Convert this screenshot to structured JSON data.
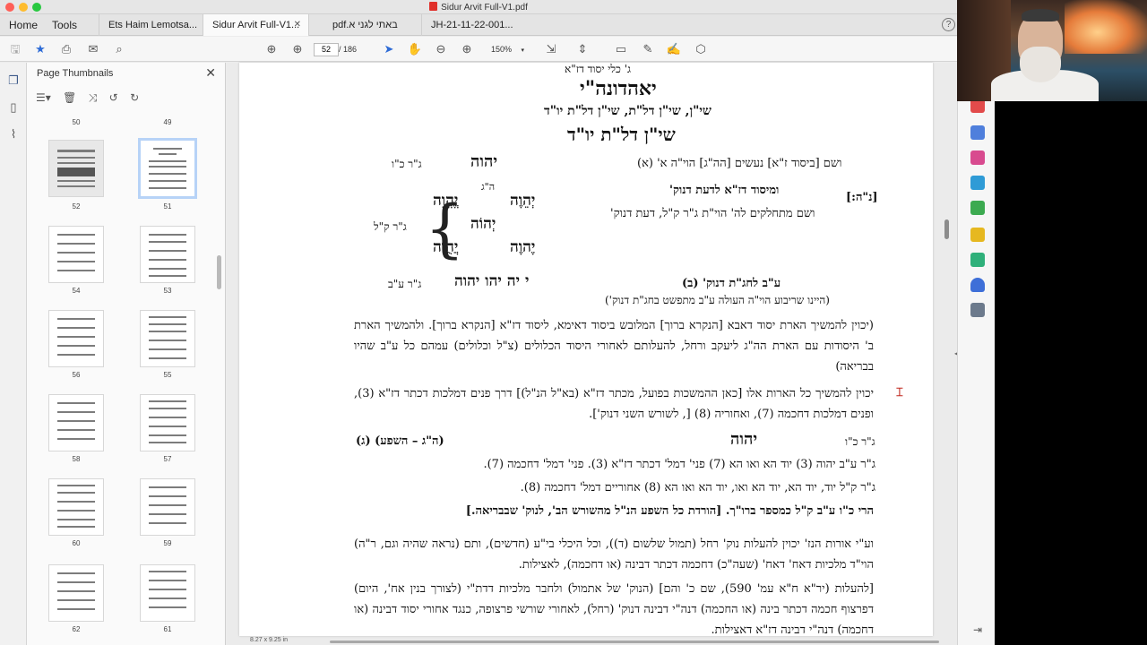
{
  "window": {
    "title": "Sidur Arvit Full-V1.pdf"
  },
  "tabs": {
    "home": "Home",
    "tools": "Tools",
    "docs": [
      {
        "label": "Ets Haim Lemotsa...",
        "active": false
      },
      {
        "label": "Sidur Arvit Full-V1...",
        "active": true
      },
      {
        "label": "pdf.באתי לגני א",
        "active": false
      },
      {
        "label": "JH-21-11-22-001...",
        "active": false
      }
    ],
    "help": "?"
  },
  "toolbar": {
    "page_current": "52",
    "page_total": "/ 186",
    "zoom": "150%"
  },
  "thumbnails": {
    "title": "Page Thumbnails",
    "pages": [
      {
        "label": "50"
      },
      {
        "label": "49"
      },
      {
        "label": "52"
      },
      {
        "label": "51"
      },
      {
        "label": "54"
      },
      {
        "label": "53"
      },
      {
        "label": "56"
      },
      {
        "label": "55"
      },
      {
        "label": "58"
      },
      {
        "label": "57"
      },
      {
        "label": "60"
      },
      {
        "label": "59"
      },
      {
        "label": "62"
      },
      {
        "label": "61"
      }
    ]
  },
  "document": {
    "page_size": "8.27 x 9.25 in",
    "l1": "ג' כלי יסוד דז\"א",
    "l2": "יאהדונה\"י",
    "l3": "שי\"ן, שי\"ן דל\"ת, שי\"ן דל\"ת יו\"ד",
    "l4": "שי\"ן דל\"ת יו\"ד",
    "l5_text": "ושם [ביסוד ז\"א] נעשים [הה\"ג] הוי\"ה א' (א)",
    "l5_name": "יהוה",
    "l5_right": "ג\"ר כ\"ו",
    "nun_he": "[נ\"ה:]",
    "l6_a": "ומיסוד דז\"א לדעת דנוק'",
    "l6_b": "ושם מתחלקים לה' הוי\"ת ג\"ר ק\"ל, דעת דנוק'",
    "he_g": "ה\"ג",
    "tree_1": "יְהֵוֶה",
    "tree_2": "יֱהֱוֵה",
    "tree_3": "יְהוֹה",
    "tree_4": "יֶהוֶה",
    "tree_5": "יֲהֻוֹה",
    "gr_kl": "ג\"ר ק\"ל",
    "l7_text": "ע\"ב לחג\"ת דנוק' (ב)",
    "l7_name": "י יה יהו יהוה",
    "l7_right": "ג\"ר ע\"ב",
    "l8": "(היינו שריבוע הוי\"ה העולה ע\"ב מתפשט בחג\"ת דנוק')",
    "para1": "(יכוין להמשיך הארת יסוד דאבא [הנקרא ברוך] המלובש ביסוד דאימא, ליסוד דז\"א [הנקרא ברוך]. ולהמשיך הארת ב' היסודות עם הארת הה\"ג ליעקב ורחל, להעלותם לאחורי היסוד הכלולים (צ\"ל וכלולים) עמהם כל ע\"ב שהיו בבריאה)",
    "para2": "יכוין להמשיך כל הארות אלו [כאן ההמשכות בפועל, מכתר דז\"א (בא\"ל הנ\"ל)] דרך פנים דמלכות דכתר דז\"א (3), ופנים דמלכות דחכמה (7), ואחוריה (8) [, לשורש השני דנוק'].",
    "row_a_left": "ג\"ר כ\"ו",
    "row_a_name": "יהוה",
    "row_a_right": "(ה\"ג – השפע) (ג)",
    "row_b": "ג\"ר ע\"ב  יהוה (3)  יוד הא ואו הא (7)  פני' דמל' דכתר דז\"א (3). פני' דמל' דחכמה (7).",
    "row_c": "ג\"ר ק\"ל  יוד, יוד הא, יוד הא ואו, יוד הא ואו הא (8)  אחוריים דמל' דחכמה (8).",
    "row_d": "הרי כ\"ו ע\"ב ק\"ל כמספר ברו\"ך. [הורדת כל השפע הנ\"ל מהשורש הב', לנוק' שבבריאה.]",
    "para3": "וע\"י אורות הנז' יכוין להעלות נוק' רחל (תמול שלשום (ד)), וכל היכלי בי\"ע (חדשים), ותם (נראה שהיה וגם, ר\"ה) הוי\"ד מלכיות דאח' דאח' (שעה\"כ) דחכמה דכתר דבינה (או דחכמה), לאצילות.",
    "para4": "[להעלות (יר\"א ח\"א עמ' 590), שם כ' והם] (הנוק' של אתמול) ולחבר מלכיות דדת\"י (לצורך בנין אח', היום) דפרצוף חכמה דכתר בינה (או החכמה) דנה\"י דבינה דנוק' (רחל), לאחורי שורשי פרצופה, כנגד אחורי יסוד דבינה (או דחכמה) דנה\"י דבינה דז\"א דאצילות."
  }
}
